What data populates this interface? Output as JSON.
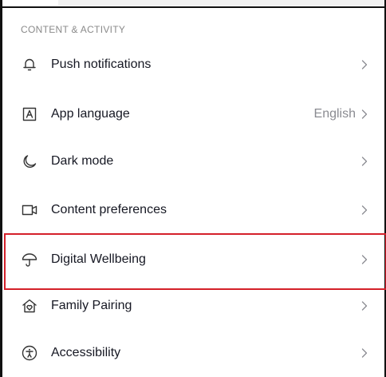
{
  "section": {
    "title": "CONTENT & ACTIVITY"
  },
  "rows": [
    {
      "label": "Push notifications",
      "value": "",
      "icon": "bell-icon"
    },
    {
      "label": "App language",
      "value": "English",
      "icon": "language-icon"
    },
    {
      "label": "Dark mode",
      "value": "",
      "icon": "moon-icon"
    },
    {
      "label": "Content preferences",
      "value": "",
      "icon": "video-icon"
    },
    {
      "label": "Digital Wellbeing",
      "value": "",
      "icon": "umbrella-icon"
    },
    {
      "label": "Family Pairing",
      "value": "",
      "icon": "home-heart-icon"
    },
    {
      "label": "Accessibility",
      "value": "",
      "icon": "accessibility-icon"
    }
  ],
  "highlight": {
    "target": "Digital Wellbeing",
    "color": "#d4202a"
  },
  "colors": {
    "label": "#161823",
    "secondary": "#8a8b91",
    "section_header": "#8a8a8a"
  }
}
